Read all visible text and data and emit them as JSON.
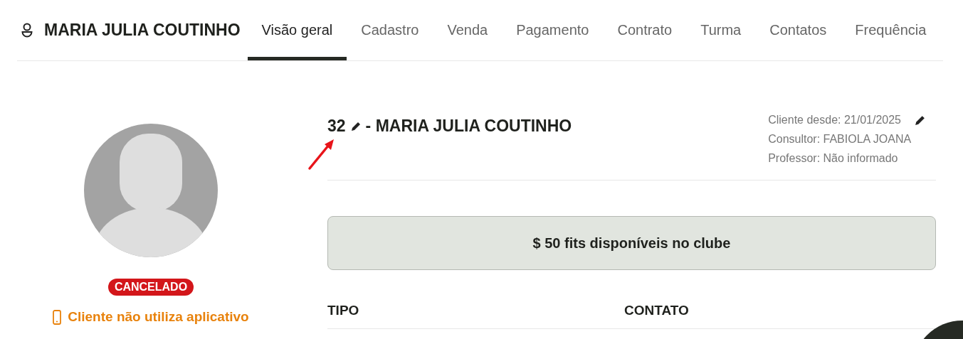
{
  "header": {
    "name": "MARIA JULIA COUTINHO"
  },
  "tabs": [
    {
      "label": "Visão geral",
      "selected": true
    },
    {
      "label": "Cadastro",
      "selected": false
    },
    {
      "label": "Venda",
      "selected": false
    },
    {
      "label": "Pagamento",
      "selected": false
    },
    {
      "label": "Contrato",
      "selected": false
    },
    {
      "label": "Turma",
      "selected": false
    },
    {
      "label": "Contatos",
      "selected": false
    },
    {
      "label": "Frequência",
      "selected": false
    }
  ],
  "profile": {
    "status": "CANCELADO",
    "app_notice": "Cliente não utiliza aplicativo"
  },
  "client": {
    "code": "32",
    "name": "- MARIA JULIA COUTINHO",
    "since": "Cliente desde: 21/01/2025",
    "consultant": "Consultor: FABIOLA JOANA",
    "teacher": "Professor: Não informado"
  },
  "fits_banner": "$ 50 fits disponíveis no clube",
  "table": {
    "columns": [
      "TIPO",
      "CONTATO"
    ]
  }
}
